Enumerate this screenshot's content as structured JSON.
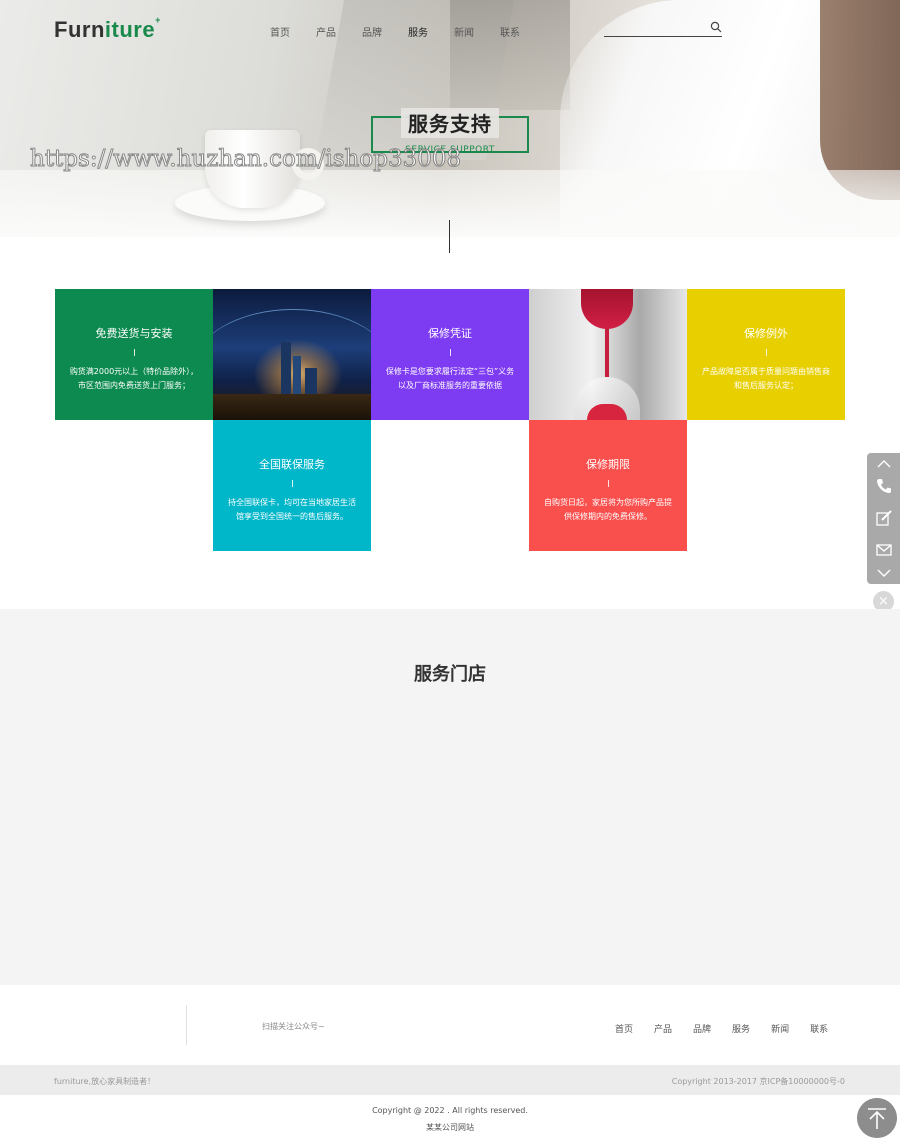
{
  "header": {
    "logo": {
      "part1": "Furn",
      "part2": "iture",
      "sup": "+"
    },
    "nav": [
      "首页",
      "产品",
      "品牌",
      "服务",
      "新闻",
      "联系"
    ],
    "active_nav": "服务",
    "search_placeholder": ""
  },
  "hero": {
    "title_cn": "服务支持",
    "title_en": "SERVICE SUPPORT",
    "watermark": "https://www.huzhan.com/ishop33008"
  },
  "services": [
    {
      "title": "免费送货与安装",
      "desc": "购货满2000元以上（特价品除外），市区范围内免费送货上门服务；",
      "color": "#0c8a4f"
    },
    {
      "title": "保修凭证",
      "desc": "保修卡是您要求履行法定“三包”义务以及厂商标准服务的重要依据",
      "color": "#7e3cf2"
    },
    {
      "title": "保修例外",
      "desc": "产品故障是否属于质量问题由销售商和售后服务认定；",
      "color": "#e7cf00"
    },
    {
      "title": "全国联保服务",
      "desc": "持全国联保卡，均可在当地家居生活馆享受到全国统一的售后服务。",
      "color": "#00b6c9"
    },
    {
      "title": "保修期限",
      "desc": "自购货日起，家居将为您所购产品提供保修期内的免费保修。",
      "color": "#f94f4d"
    }
  ],
  "float_bar": {
    "icons": [
      "chevron-up-icon",
      "phone-icon",
      "edit-icon",
      "mail-icon",
      "chevron-down-icon"
    ],
    "close": "×"
  },
  "store": {
    "title": "服务门店"
  },
  "footer": {
    "qr_text": "扫描关注公众号~",
    "nav": [
      "首页",
      "产品",
      "品牌",
      "服务",
      "新闻",
      "联系"
    ],
    "slogan": "furniture,放心家具制造者！",
    "icp": "Copyright 2013-2017 京ICP备10000000号-0",
    "copyright": "Copyright @ 2022 . All rights reserved.",
    "company": "某某公司网站"
  },
  "colors": {
    "brand_green": "#1a8a4c",
    "float_bar": "#a9a9a9"
  }
}
